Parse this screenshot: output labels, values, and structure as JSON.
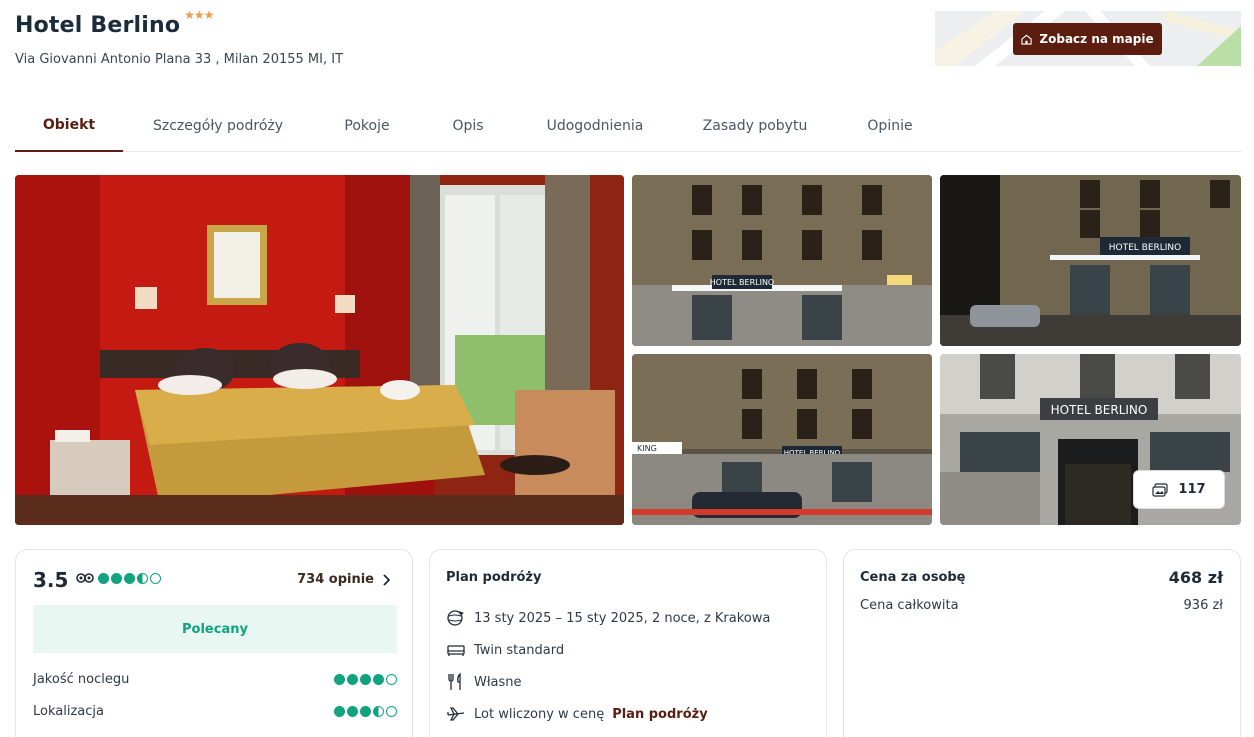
{
  "hotel": {
    "name": "Hotel Berlino",
    "stars": "★★★",
    "address": "Via Giovanni Antonio Plana 33 , Milan 20155 MI, IT"
  },
  "map": {
    "button_label": "Zobacz na mapie"
  },
  "tabs": [
    {
      "label": "Obiekt",
      "active": true
    },
    {
      "label": "Szczegóły podróży"
    },
    {
      "label": "Pokoje"
    },
    {
      "label": "Opis"
    },
    {
      "label": "Udogodnienia"
    },
    {
      "label": "Zasady pobytu"
    },
    {
      "label": "Opinie"
    }
  ],
  "gallery": {
    "photo_count": "117",
    "sign_text": "HOTEL BERLINO",
    "parking_text": "KING"
  },
  "rating": {
    "score": "3.5",
    "reviews_label": "734 opinie",
    "badge": "Polecany",
    "criteria": [
      {
        "label": "Jakość noclegu",
        "value": 4
      },
      {
        "label": "Lokalizacja",
        "value": 3.5
      }
    ]
  },
  "plan": {
    "title": "Plan podróży",
    "dates": "13 sty 2025 – 15 sty 2025, 2 noce, z Krakowa",
    "room": "Twin standard",
    "meals": "Własne",
    "flight_prefix": "Lot wliczony w cenę",
    "flight_link": "Plan podróży"
  },
  "price": {
    "per_person_label": "Cena za osobę",
    "per_person_value": "468 zł",
    "total_label": "Cena całkowita",
    "total_value": "936 zł"
  },
  "colors": {
    "accent": "#5a1d0f",
    "rating_green": "#10a37f",
    "star": "#f2994a"
  }
}
